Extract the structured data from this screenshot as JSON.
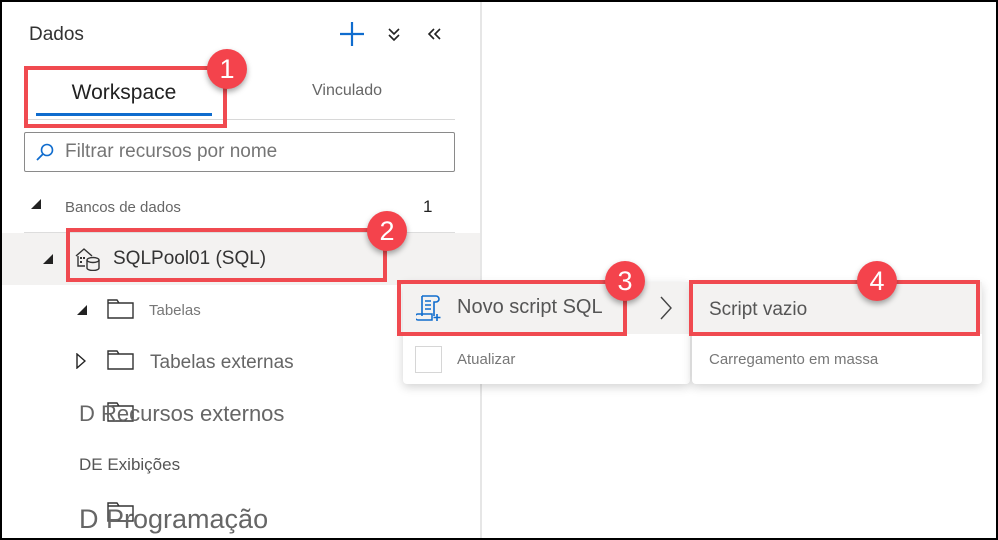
{
  "panel": {
    "title": "Dados",
    "header_icons": [
      "add-icon",
      "expand-all-icon",
      "collapse-panel-icon"
    ],
    "accent_color": "#0f6cce"
  },
  "tabs": [
    {
      "label": "Workspace",
      "selected": true
    },
    {
      "label": "Vinculado",
      "selected": false
    }
  ],
  "search": {
    "placeholder": "Filtrar recursos por nome",
    "value": ""
  },
  "tree": {
    "databases": {
      "label": "Bancos de dados",
      "count": "1",
      "expanded": true
    },
    "pool": {
      "label": "SQLPool01 (SQL)",
      "icon": "sql-pool-icon",
      "expanded": true
    },
    "children": [
      {
        "label": "Tabelas",
        "caret": "expanded"
      },
      {
        "label": "Tabelas externas",
        "caret": "collapsed"
      },
      {
        "label": "Recursos externos",
        "prefix": "D"
      },
      {
        "label": "Exibições",
        "prefix": "DE Ex"
      },
      {
        "label": "Programação",
        "prefix": "D"
      }
    ],
    "glitched_labels": {
      "external_resources": "D Recursos externos",
      "views": "DE Exibições",
      "programming": "D Programação"
    }
  },
  "context_menu": {
    "items": [
      {
        "label": "Novo script SQL",
        "icon": "sql-script-icon",
        "has_submenu": true
      },
      {
        "label": "Atualizar",
        "icon": "refresh-icon"
      }
    ]
  },
  "submenu": {
    "items": [
      {
        "label": "Script vazio",
        "highlighted": true
      },
      {
        "label": "Carregamento em massa"
      }
    ]
  },
  "callouts": [
    {
      "number": "1",
      "target": "Workspace tab"
    },
    {
      "number": "2",
      "target": "SQLPool01 (SQL)"
    },
    {
      "number": "3",
      "target": "Novo script SQL"
    },
    {
      "number": "4",
      "target": "Script vazio"
    }
  ],
  "callout_color": "#f4434c"
}
